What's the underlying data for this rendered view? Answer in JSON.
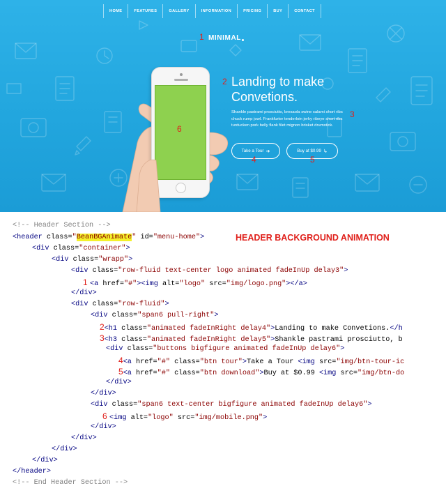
{
  "nav": {
    "items": [
      "HOME",
      "FEATURES",
      "GALLERY",
      "INFORMATION",
      "PRICING",
      "BUY",
      "CONTACT"
    ]
  },
  "hero": {
    "logo": "MINIMAL",
    "headline": "Landing to make Convetions.",
    "subtext": "Shankle pastrami prosciutto, bresaola swine salami short ribs chuck rump jowl. Frankfurter tenderloin jerky ribeye short ribs turducken pork belly flank filet mignon brisket drumstick.",
    "tour_button": "Take a Tour",
    "buy_button": "Buy at $0.99",
    "markers": [
      "1",
      "2",
      "3",
      "4",
      "5",
      "6"
    ],
    "colors": {
      "background": "#22a6de",
      "phone_screen": "#8ed14f",
      "marker": "#e0201b"
    }
  },
  "code": {
    "annotation": "HEADER BACKGROUND ANIMATION",
    "lines": [
      {
        "parts": [
          {
            "k": "c",
            "s": "<!-- Header Section -->"
          }
        ]
      },
      {
        "parts": [
          {
            "k": "t",
            "s": "<header "
          },
          {
            "k": "a",
            "s": "class="
          },
          {
            "k": "v",
            "s": "\""
          },
          {
            "k": "hl",
            "s": "BeanBGAnimate"
          },
          {
            "k": "v",
            "s": "\""
          },
          {
            "k": "a",
            "s": " id="
          },
          {
            "k": "v",
            "s": "\"menu-home\""
          },
          {
            "k": "t",
            "s": ">"
          }
        ]
      },
      {
        "parts": [
          {
            "k": "t",
            "s": "<div "
          },
          {
            "k": "a",
            "s": "class="
          },
          {
            "k": "v",
            "s": "\"container\""
          },
          {
            "k": "t",
            "s": ">"
          }
        ]
      },
      {
        "parts": [
          {
            "k": "t",
            "s": "<div "
          },
          {
            "k": "a",
            "s": "class="
          },
          {
            "k": "v",
            "s": "\"wrapp\""
          },
          {
            "k": "t",
            "s": ">"
          }
        ]
      },
      {
        "parts": [
          {
            "k": "t",
            "s": "<div "
          },
          {
            "k": "a",
            "s": "class="
          },
          {
            "k": "v",
            "s": "\"row-fluid text-center logo animated fadeInUp delay3\""
          },
          {
            "k": "t",
            "s": ">"
          }
        ]
      },
      {
        "parts": [
          {
            "k": "m",
            "s": "1 "
          },
          {
            "k": "t",
            "s": "<a "
          },
          {
            "k": "a",
            "s": "href="
          },
          {
            "k": "v",
            "s": "\"#\""
          },
          {
            "k": "t",
            "s": "><img "
          },
          {
            "k": "a",
            "s": "alt="
          },
          {
            "k": "v",
            "s": "\"logo\""
          },
          {
            "k": "a",
            "s": " src="
          },
          {
            "k": "v",
            "s": "\"img/logo.png\""
          },
          {
            "k": "t",
            "s": "></a>"
          }
        ]
      },
      {
        "parts": [
          {
            "k": "t",
            "s": "</div>"
          }
        ]
      },
      {
        "parts": [
          {
            "k": "t",
            "s": "<div "
          },
          {
            "k": "a",
            "s": "class="
          },
          {
            "k": "v",
            "s": "\"row-fluid\""
          },
          {
            "k": "t",
            "s": ">"
          }
        ]
      },
      {
        "parts": [
          {
            "k": "t",
            "s": "<div "
          },
          {
            "k": "a",
            "s": "class="
          },
          {
            "k": "v",
            "s": "\"span6 pull-right\""
          },
          {
            "k": "t",
            "s": ">"
          }
        ]
      },
      {
        "parts": [
          {
            "k": "m",
            "s": "2"
          },
          {
            "k": "t",
            "s": "<h1 "
          },
          {
            "k": "a",
            "s": "class="
          },
          {
            "k": "v",
            "s": "\"animated fadeInRight delay4\""
          },
          {
            "k": "t",
            "s": ">"
          },
          {
            "k": "x",
            "s": "Landing to make Convetions."
          },
          {
            "k": "t",
            "s": "</h"
          }
        ]
      },
      {
        "parts": [
          {
            "k": "m",
            "s": "3"
          },
          {
            "k": "t",
            "s": "<h3 "
          },
          {
            "k": "a",
            "s": "class="
          },
          {
            "k": "v",
            "s": "\"animated fadeInRight delay5\""
          },
          {
            "k": "t",
            "s": ">"
          },
          {
            "k": "x",
            "s": "Shankle pastrami prosciutto, b"
          }
        ]
      },
      {
        "parts": [
          {
            "k": "t",
            "s": "<div "
          },
          {
            "k": "a",
            "s": "class="
          },
          {
            "k": "v",
            "s": "\"buttons bigfigure animated fadeInUp delay6\""
          },
          {
            "k": "t",
            "s": ">"
          }
        ]
      },
      {
        "parts": [
          {
            "k": "m",
            "s": "4"
          },
          {
            "k": "t",
            "s": "<a "
          },
          {
            "k": "a",
            "s": "href="
          },
          {
            "k": "v",
            "s": "\"#\""
          },
          {
            "k": "a",
            "s": " class="
          },
          {
            "k": "v",
            "s": "\"btn tour\""
          },
          {
            "k": "t",
            "s": ">"
          },
          {
            "k": "x",
            "s": "Take a Tour "
          },
          {
            "k": "t",
            "s": "<img "
          },
          {
            "k": "a",
            "s": "src="
          },
          {
            "k": "v",
            "s": "\"img/btn-tour-ic"
          }
        ]
      },
      {
        "parts": [
          {
            "k": "m",
            "s": "5"
          },
          {
            "k": "t",
            "s": "<a "
          },
          {
            "k": "a",
            "s": "href="
          },
          {
            "k": "v",
            "s": "\"#\""
          },
          {
            "k": "a",
            "s": " class="
          },
          {
            "k": "v",
            "s": "\"btn download\""
          },
          {
            "k": "t",
            "s": ">"
          },
          {
            "k": "x",
            "s": "Buy at $0.99 "
          },
          {
            "k": "t",
            "s": "<img "
          },
          {
            "k": "a",
            "s": "src="
          },
          {
            "k": "v",
            "s": "\"img/btn-do"
          }
        ]
      },
      {
        "parts": [
          {
            "k": "t",
            "s": "</div>"
          }
        ]
      },
      {
        "parts": [
          {
            "k": "t",
            "s": "</div>"
          }
        ]
      },
      {
        "parts": [
          {
            "k": "t",
            "s": "<div "
          },
          {
            "k": "a",
            "s": "class="
          },
          {
            "k": "v",
            "s": "\"span6 text-center bigfigure animated fadeInUp delay6\""
          },
          {
            "k": "t",
            "s": ">"
          }
        ]
      },
      {
        "parts": [
          {
            "k": "m",
            "s": "6 "
          },
          {
            "k": "t",
            "s": "<img "
          },
          {
            "k": "a",
            "s": "alt="
          },
          {
            "k": "v",
            "s": "\"logo\""
          },
          {
            "k": "a",
            "s": " src="
          },
          {
            "k": "v",
            "s": "\"img/mobile.png\""
          },
          {
            "k": "t",
            "s": ">"
          }
        ]
      },
      {
        "parts": [
          {
            "k": "t",
            "s": "</div>"
          }
        ]
      },
      {
        "parts": [
          {
            "k": "t",
            "s": "</div>"
          }
        ]
      },
      {
        "parts": [
          {
            "k": "t",
            "s": "</div>"
          }
        ]
      },
      {
        "parts": [
          {
            "k": "t",
            "s": "</div>"
          }
        ]
      },
      {
        "parts": [
          {
            "k": "t",
            "s": "</header>"
          }
        ]
      },
      {
        "parts": [
          {
            "k": "c",
            "s": "<!-- End Header Section -->"
          }
        ]
      }
    ]
  }
}
